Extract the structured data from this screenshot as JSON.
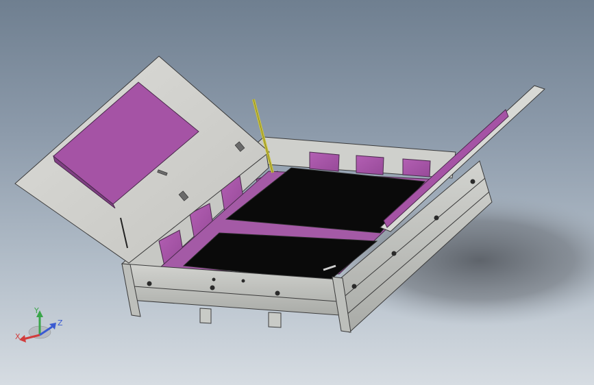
{
  "viewport": {
    "background_top": "#6f7f90",
    "background_bottom": "#d6dce2"
  },
  "model": {
    "frame_color": "#c9cbc7",
    "edge_color": "#3a3a3a",
    "foam_color": "#a553a5",
    "foam_dark": "#7f3f83",
    "cavity_color": "#0a0a0a",
    "rod_color": "#c9c23c"
  },
  "triad": {
    "x_label": "X",
    "y_label": "Y",
    "z_label": "Z",
    "x_color": "#d23c3c",
    "y_color": "#3aa54a",
    "z_color": "#3a5ad2",
    "x_icon": "x-axis-arrow-icon",
    "y_icon": "y-axis-arrow-icon",
    "z_icon": "z-axis-arrow-icon"
  }
}
